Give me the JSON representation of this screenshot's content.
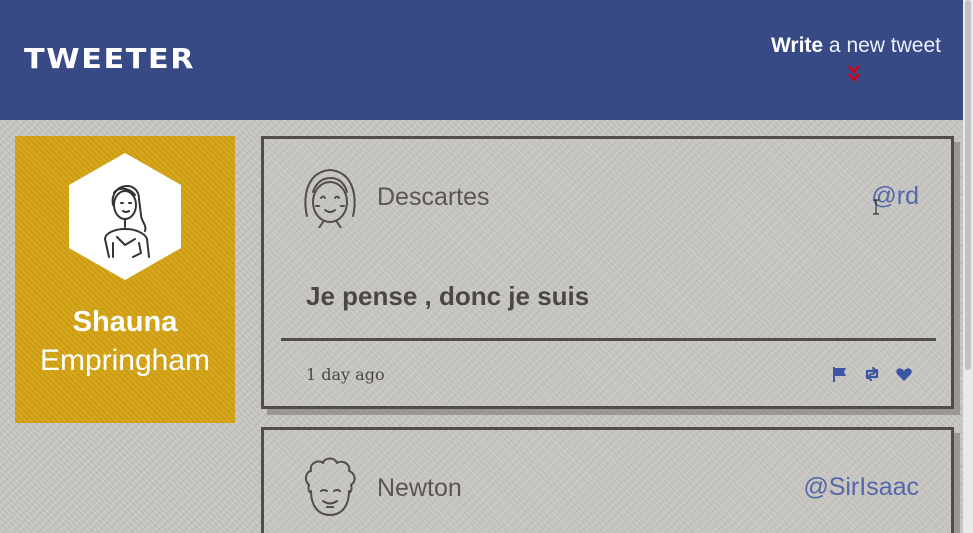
{
  "navbar": {
    "brand": "TWEETER",
    "compose_bold": "Write",
    "compose_rest": " a new tweet",
    "accent": "#d0021b",
    "background": "#374a86"
  },
  "profile": {
    "first_name": "Shauna",
    "last_name": "Empringham",
    "background": "#d4a312",
    "avatar_icon": "user-avatar-icon"
  },
  "tweets": [
    {
      "name": "Descartes",
      "handle": "@rd",
      "text": "Je pense , donc je suis",
      "time": "1 day ago",
      "avatar_icon": "girl-avatar-icon",
      "actions": [
        "flag-icon",
        "retweet-icon",
        "heart-icon"
      ]
    },
    {
      "name": "Newton",
      "handle": "@SirIsaac",
      "avatar_icon": "curly-hair-avatar-icon"
    }
  ]
}
